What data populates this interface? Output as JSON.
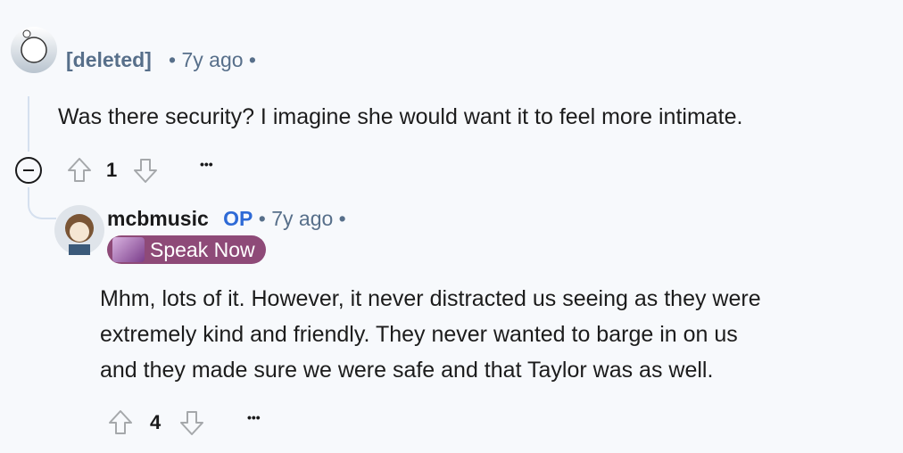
{
  "comments": [
    {
      "author": "[deleted]",
      "time": "7y ago",
      "body": "Was there security? I imagine she would want it to feel more intimate.",
      "score": "1",
      "more": "•••"
    },
    {
      "author": "mcbmusic",
      "op": "OP",
      "time": "7y ago",
      "flair": "Speak Now",
      "body": [
        "Mhm, lots of it. However, it never distracted us seeing as they were",
        "extremely kind and friendly. They never wanted to barge in on us",
        "and they made sure we were safe and that Taylor was as well."
      ],
      "score": "4",
      "more": "•••"
    }
  ],
  "colors": {
    "op": "#2e6ad6",
    "flair_bg": "#8e4a78",
    "meta": "#576f8a"
  }
}
